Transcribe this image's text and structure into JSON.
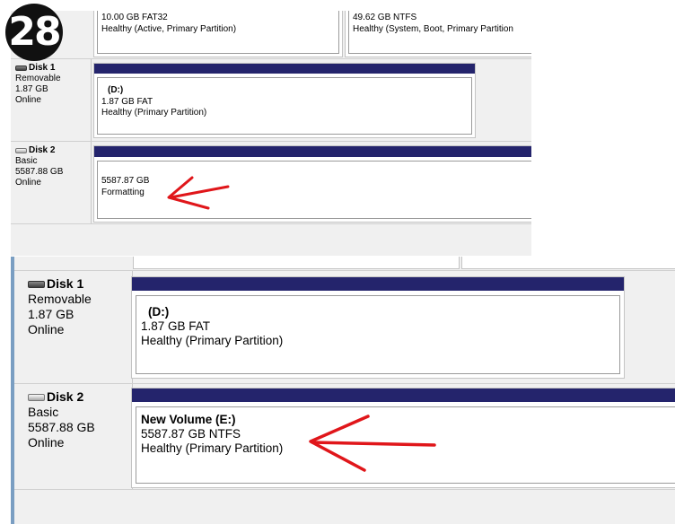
{
  "step_number": "28",
  "top_screenshot": {
    "partial_row": {
      "left_partition": {
        "line1": "10.00 GB FAT32",
        "line2": "Healthy (Active, Primary Partition)"
      },
      "right_partition": {
        "line1": "49.62 GB NTFS",
        "line2": "Healthy (System, Boot, Primary Partition"
      }
    },
    "disk1": {
      "name": "Disk 1",
      "type": "Removable",
      "size": "1.87 GB",
      "status": "Online",
      "icon": "hdd-removable-icon",
      "partition": {
        "label": "(D:)",
        "size_fs": "1.87 GB FAT",
        "health": "Healthy (Primary Partition)"
      }
    },
    "disk2": {
      "name": "Disk 2",
      "type": "Basic",
      "size": "5587.88 GB",
      "status": "Online",
      "icon": "hdd-basic-icon",
      "partition": {
        "size": "5587.87 GB",
        "state": "Formatting"
      }
    }
  },
  "bottom_screenshot": {
    "disk1": {
      "name": "Disk 1",
      "type": "Removable",
      "size": "1.87 GB",
      "status": "Online",
      "icon": "hdd-removable-icon",
      "partition": {
        "label": "(D:)",
        "size_fs": "1.87 GB FAT",
        "health": "Healthy (Primary Partition)"
      }
    },
    "disk2": {
      "name": "Disk 2",
      "type": "Basic",
      "size": "5587.88 GB",
      "status": "Online",
      "icon": "hdd-basic-icon",
      "partition": {
        "label": "New Volume  (E:)",
        "size_fs": "5587.87 GB NTFS",
        "health": "Healthy (Primary Partition)"
      }
    }
  },
  "colors": {
    "partition_bar": "#24246c",
    "annotation_arrow": "#e0161a",
    "background": "#f0f0f0"
  }
}
